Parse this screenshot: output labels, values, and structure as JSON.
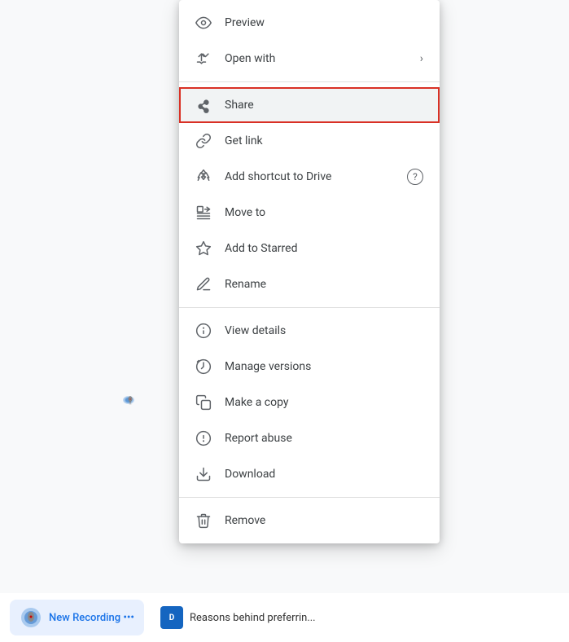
{
  "menu": {
    "items": [
      {
        "id": "preview",
        "label": "Preview",
        "icon": "eye-icon",
        "has_arrow": false,
        "has_help": false,
        "highlighted": false,
        "divider_after": false
      },
      {
        "id": "open-with",
        "label": "Open with",
        "icon": "open-with-icon",
        "has_arrow": true,
        "has_help": false,
        "highlighted": false,
        "divider_after": true
      },
      {
        "id": "share",
        "label": "Share",
        "icon": "share-icon",
        "has_arrow": false,
        "has_help": false,
        "highlighted": true,
        "divider_after": false
      },
      {
        "id": "get-link",
        "label": "Get link",
        "icon": "link-icon",
        "has_arrow": false,
        "has_help": false,
        "highlighted": false,
        "divider_after": false
      },
      {
        "id": "add-shortcut",
        "label": "Add shortcut to Drive",
        "icon": "shortcut-icon",
        "has_arrow": false,
        "has_help": true,
        "highlighted": false,
        "divider_after": false
      },
      {
        "id": "move-to",
        "label": "Move to",
        "icon": "move-icon",
        "has_arrow": false,
        "has_help": false,
        "highlighted": false,
        "divider_after": false
      },
      {
        "id": "add-starred",
        "label": "Add to Starred",
        "icon": "star-icon",
        "has_arrow": false,
        "has_help": false,
        "highlighted": false,
        "divider_after": false
      },
      {
        "id": "rename",
        "label": "Rename",
        "icon": "rename-icon",
        "has_arrow": false,
        "has_help": false,
        "highlighted": false,
        "divider_after": true
      },
      {
        "id": "view-details",
        "label": "View details",
        "icon": "info-icon",
        "has_arrow": false,
        "has_help": false,
        "highlighted": false,
        "divider_after": false
      },
      {
        "id": "manage-versions",
        "label": "Manage versions",
        "icon": "versions-icon",
        "has_arrow": false,
        "has_help": false,
        "highlighted": false,
        "divider_after": false
      },
      {
        "id": "make-copy",
        "label": "Make a copy",
        "icon": "copy-icon",
        "has_arrow": false,
        "has_help": false,
        "highlighted": false,
        "divider_after": false
      },
      {
        "id": "report-abuse",
        "label": "Report abuse",
        "icon": "report-icon",
        "has_arrow": false,
        "has_help": false,
        "highlighted": false,
        "divider_after": false
      },
      {
        "id": "download",
        "label": "Download",
        "icon": "download-icon",
        "has_arrow": false,
        "has_help": false,
        "highlighted": false,
        "divider_after": true
      },
      {
        "id": "remove",
        "label": "Remove",
        "icon": "trash-icon",
        "has_arrow": false,
        "has_help": false,
        "highlighted": false,
        "divider_after": false
      }
    ]
  },
  "bottom_bar": {
    "item1_text": "New Recording •••",
    "item2_text": "Reasons behind preferrin..."
  }
}
